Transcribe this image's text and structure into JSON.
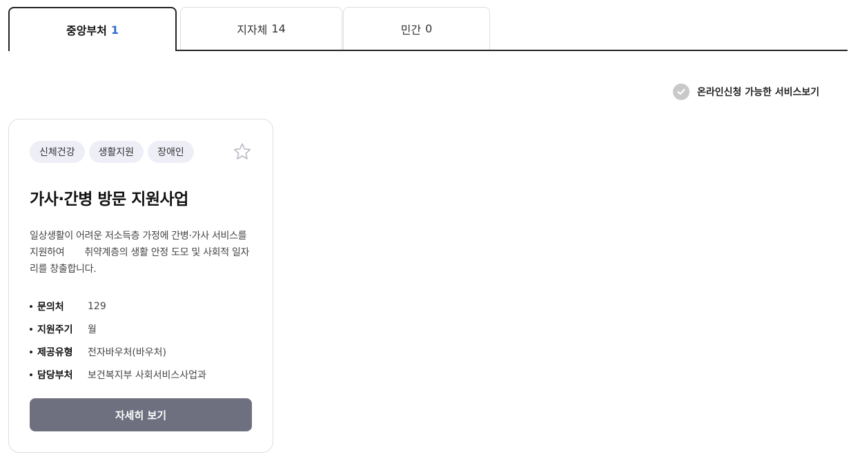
{
  "tabs": [
    {
      "label": "중앙부처",
      "count": "1",
      "active": true
    },
    {
      "label": "지자체",
      "count": "14",
      "active": false
    },
    {
      "label": "민간",
      "count": "0",
      "active": false
    }
  ],
  "online_filter": {
    "label": "온라인신청 가능한 서비스보기",
    "icon": "check-circle-icon"
  },
  "card": {
    "tags": [
      "신체건강",
      "생활지원",
      "장애인"
    ],
    "title": "가사·간병 방문 지원사업",
    "description": "일상생활이 어려운 저소득층 가정에 간병·가사 서비스를 지원하여       취약계층의 생활 안정 도모 및 사회적 일자리를 창출합니다.",
    "info": [
      {
        "key": "문의처",
        "value": "129"
      },
      {
        "key": "지원주기",
        "value": "월"
      },
      {
        "key": "제공유형",
        "value": "전자바우처(바우처)"
      },
      {
        "key": "담당부처",
        "value": "보건복지부 사회서비스사업과"
      }
    ],
    "detail_button": "자세히 보기",
    "favorite_icon": "star-outline-icon"
  },
  "colors": {
    "accent": "#2f6bd6",
    "button": "#6e7080",
    "tag_bg": "#eeeef7"
  }
}
